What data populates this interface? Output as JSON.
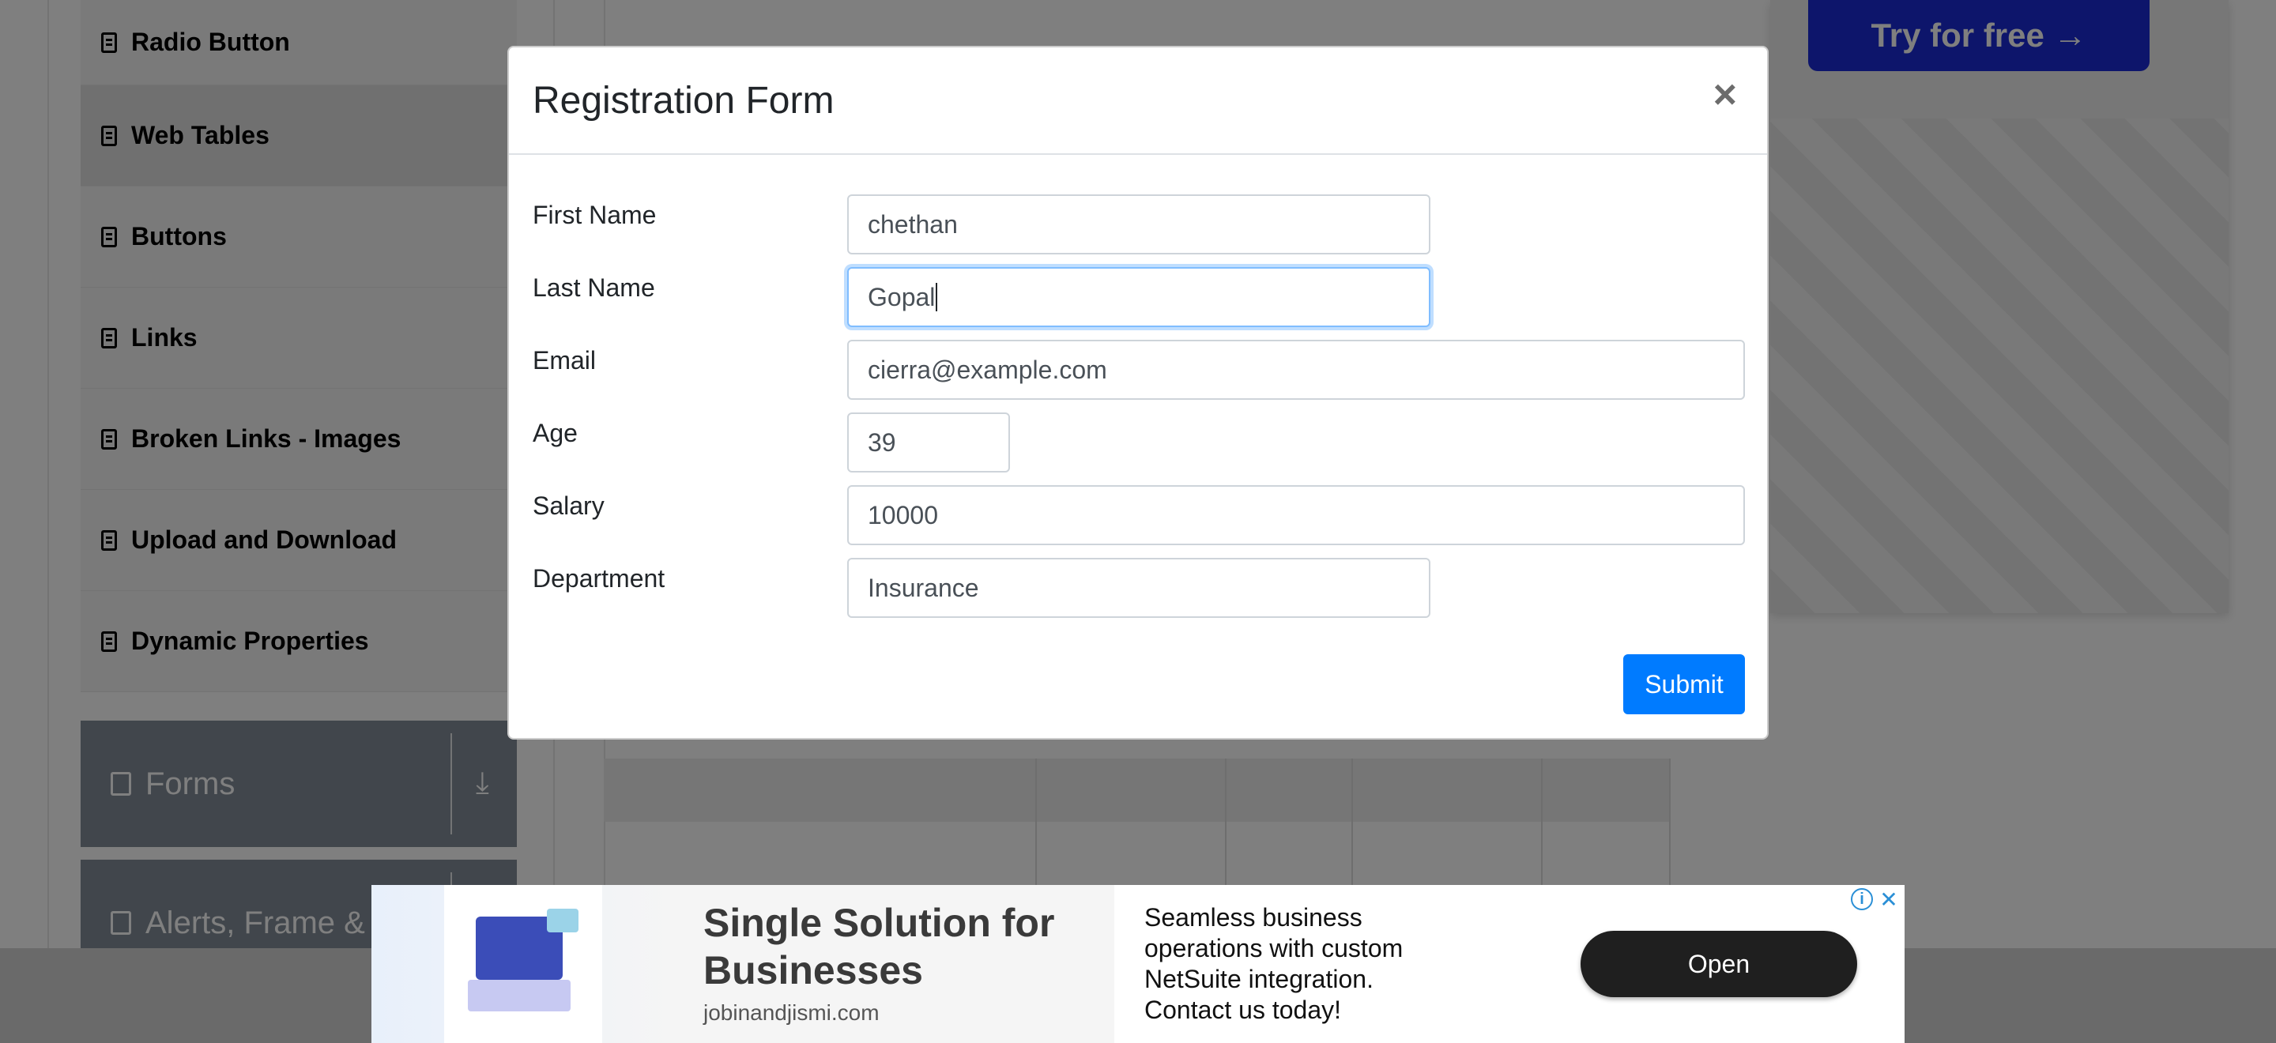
{
  "sidebar": {
    "items": [
      {
        "label": "Radio Button",
        "icon": "list-icon"
      },
      {
        "label": "Web Tables",
        "icon": "list-icon",
        "active": true
      },
      {
        "label": "Buttons",
        "icon": "list-icon"
      },
      {
        "label": "Links",
        "icon": "list-icon"
      },
      {
        "label": "Broken Links - Images",
        "icon": "list-icon"
      },
      {
        "label": "Upload and Download",
        "icon": "list-icon"
      },
      {
        "label": "Dynamic Properties",
        "icon": "list-icon"
      }
    ],
    "groups": [
      {
        "label": "Forms",
        "icon": "form-icon"
      },
      {
        "label": "Alerts, Frame &",
        "icon": "window-icon"
      }
    ]
  },
  "ad_right": {
    "button": "Try for free →"
  },
  "modal": {
    "title": "Registration Form",
    "close": "×",
    "fields": {
      "first_name": {
        "label": "First Name",
        "value": "chethan"
      },
      "last_name": {
        "label": "Last Name",
        "value": "Gopal"
      },
      "email": {
        "label": "Email",
        "value": "cierra@example.com"
      },
      "age": {
        "label": "Age",
        "value": "39"
      },
      "salary": {
        "label": "Salary",
        "value": "10000"
      },
      "department": {
        "label": "Department",
        "value": "Insurance"
      }
    },
    "submit": "Submit"
  },
  "bottom_ad": {
    "title": "Single Solution for Businesses",
    "domain": "jobinandjismi.com",
    "description": "Seamless business operations with custom NetSuite integration. Contact us today!",
    "open": "Open",
    "info": "i",
    "close": "✕"
  },
  "colors": {
    "accent": "#007bff",
    "sidebar_group": "#828d99",
    "try_button": "#1a2bd6"
  }
}
